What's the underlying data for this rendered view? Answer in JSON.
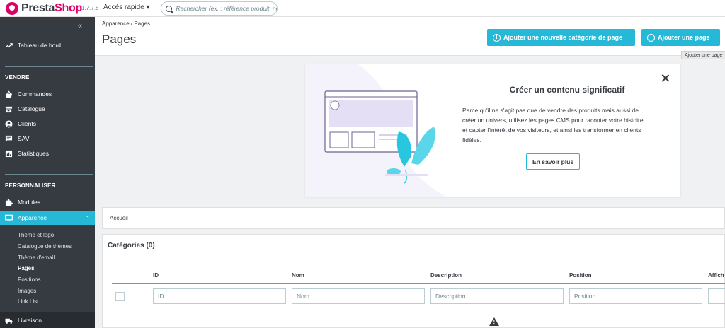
{
  "topbar": {
    "logo_prefix": "Presta",
    "logo_suffix": "Shop",
    "version": "1.7.7.8",
    "quick_access": "Accès rapide ▾",
    "search_placeholder": "Rechercher (ex. : référence produit, nom"
  },
  "sidebar": {
    "collapse": "«",
    "dashboard": "Tableau de bord",
    "section_sell": "VENDRE",
    "sell_items": [
      "Commandes",
      "Catalogue",
      "Clients",
      "SAV",
      "Statistiques"
    ],
    "section_customize": "PERSONNALISER",
    "modules": "Modules",
    "appearance": "Apparence",
    "appearance_sub": [
      "Thème et logo",
      "Catalogue de thèmes",
      "Thème d'email",
      "Pages",
      "Positions",
      "Images",
      "Link List"
    ],
    "shipping": "Livraison"
  },
  "header": {
    "breadcrumb": "Apparence  /  Pages",
    "title": "Pages",
    "btn_add_category": "Ajouter une nouvelle catégorie de page",
    "btn_add_page": "Ajouter une page",
    "tooltip": "Ajouter une page"
  },
  "promo": {
    "title": "Créer un contenu significatif",
    "text": "Parce qu'il ne s'agit pas que de vendre des produits mais aussi de créer un univers, utilisez les pages CMS pour raconter votre histoire et capter l'intérêt de vos visiteurs, et ainsi les transformer en clients fidèles.",
    "button": "En savoir plus"
  },
  "category_breadcrumb": "Accueil",
  "categories": {
    "title": "Catégories (0)",
    "columns": [
      "ID",
      "Nom",
      "Description",
      "Position",
      "Affich"
    ],
    "filters": [
      "ID",
      "Nom",
      "Description",
      "Position"
    ]
  },
  "colors": {
    "accent": "#25b9d7",
    "sidebar": "#363a41",
    "brand": "#df0067"
  }
}
